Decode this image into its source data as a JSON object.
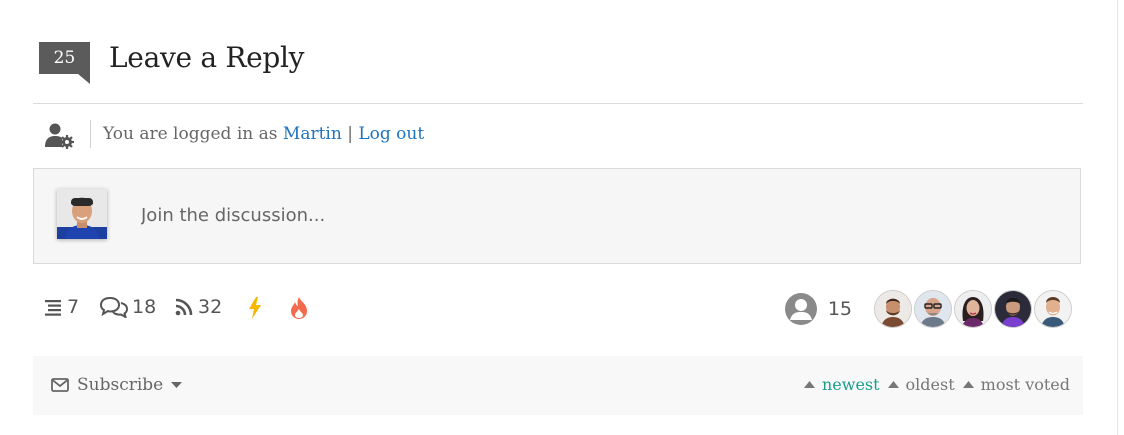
{
  "header": {
    "comment_count": "25",
    "title": "Leave a Reply"
  },
  "login": {
    "prefix": "You are logged in as ",
    "username": "Martin",
    "separator": " | ",
    "logout_label": "Log out"
  },
  "composer": {
    "placeholder": "Join the discussion..."
  },
  "stats": {
    "threads": "7",
    "replies": "18",
    "followers": "32",
    "hot_icon": "bolt-icon",
    "fire_icon": "fire-icon",
    "commenters_count": "15"
  },
  "sort_bar": {
    "subscribe_label": "Subscribe",
    "sort_options": [
      "newest",
      "oldest",
      "most voted"
    ],
    "active_sort": "newest"
  },
  "colors": {
    "accent_link": "#1e73be",
    "active_sort": "#1a9e8a",
    "bolt": "#f5b700",
    "fire": "#f26b4e"
  }
}
